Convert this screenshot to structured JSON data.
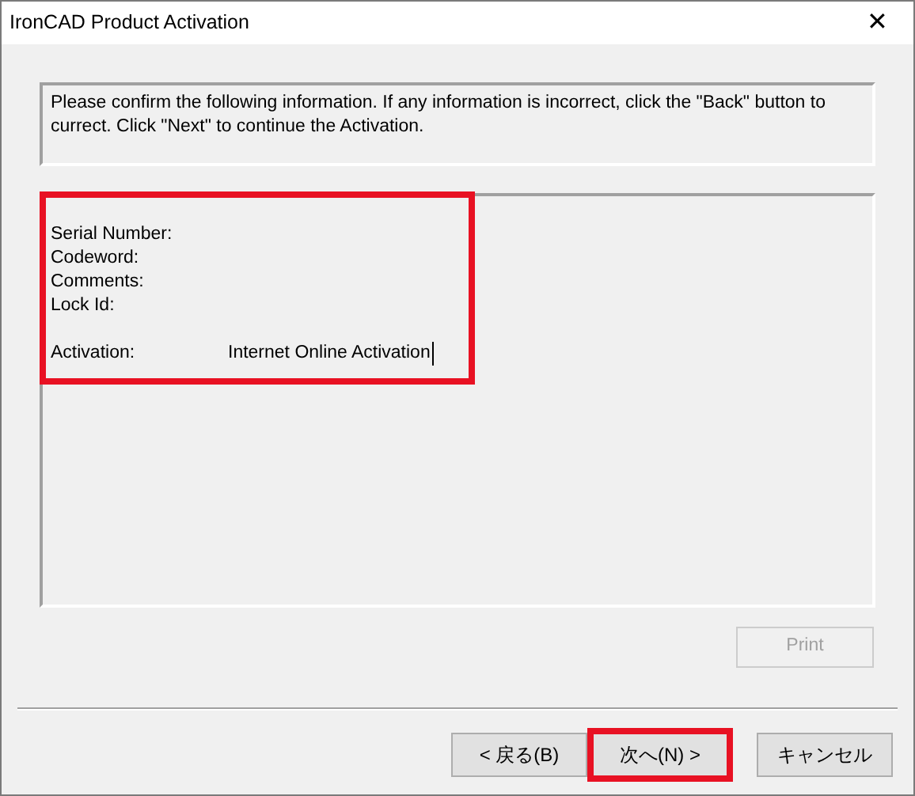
{
  "window": {
    "title": "IronCAD Product Activation",
    "close": "✕"
  },
  "message": "Please confirm the following information. If any information is incorrect, click the \"Back\" button to currect. Click \"Next\" to continue the Activation.",
  "info": [
    {
      "label": "Serial Number:"
    },
    {
      "label": "Codeword:"
    },
    {
      "label": "Comments:"
    },
    {
      "label": "Lock Id:"
    },
    {
      "label": "Activation:",
      "value": "Internet Online Activation",
      "gap_before": true
    }
  ],
  "print_button": {
    "label": "Print",
    "disabled": true
  },
  "buttons": [
    {
      "label": "< 戻る(B)",
      "highlighted": false
    },
    {
      "label": "次へ(N) >",
      "highlighted": true
    },
    {
      "label": "キャンセル",
      "highlighted": false
    }
  ]
}
